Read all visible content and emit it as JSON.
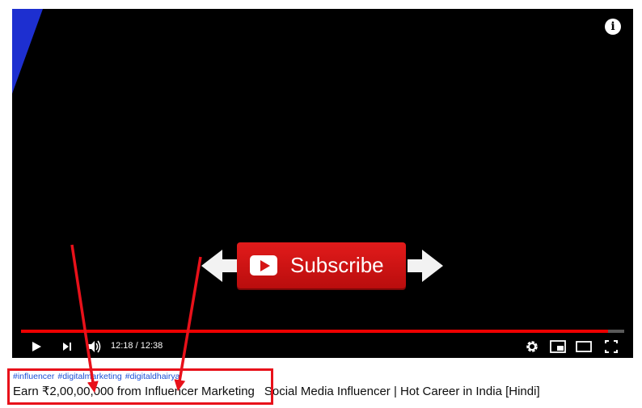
{
  "video": {
    "overlay_button_label": "Subscribe",
    "time_current": "12:18",
    "time_separator": "/",
    "time_total": "12:38",
    "progress": 0.9736,
    "progress_color": "#ee0000"
  },
  "controls": {
    "icons": [
      "play-icon",
      "next-icon",
      "volume-icon",
      "settings-icon",
      "miniplayer-icon",
      "theater-icon",
      "fullscreen-icon"
    ]
  },
  "title": {
    "hashtags": [
      "#influencer",
      "#digitalmarketing",
      "#digitaldhairya"
    ],
    "part1": "Earn ₹2,00,00,000 from Influencer Marketing",
    "part2": "Social Media Influencer | Hot Career in India [Hindi]"
  },
  "colors": {
    "annotation": "#e8111a",
    "hashtag": "#1a4fd6",
    "subscribe_button": "#d51414"
  }
}
